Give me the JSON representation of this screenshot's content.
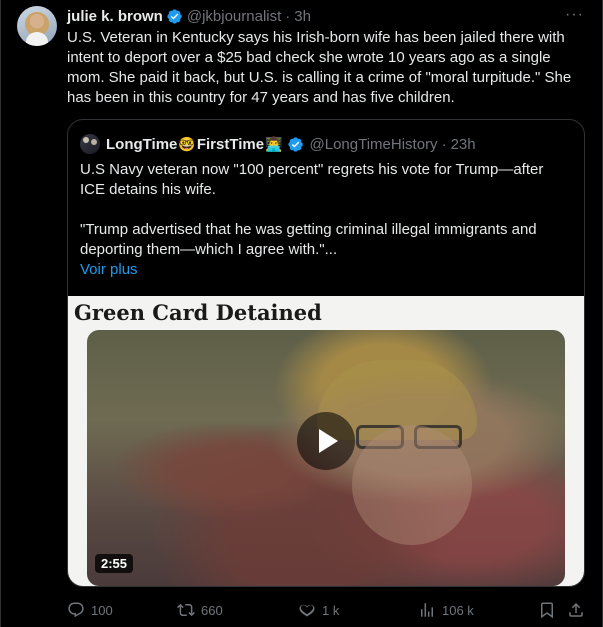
{
  "tweet": {
    "author_name": "julie k. brown",
    "handle": "@jkbjournalist",
    "separator": "·",
    "time": "3h",
    "more_label": "···",
    "text": "U.S. Veteran in Kentucky says his Irish-born wife has been jailed there with intent to deport over a $25 bad check she wrote 10 years ago as a single mom. She paid it back, but U.S. is calling it a crime of \"moral turpitude.\" She has been in this country for 47 years and has five children."
  },
  "quote": {
    "name_part1": "LongTime",
    "emoji1": "🤓",
    "name_part2": "FirstTime",
    "emoji2": "👨‍💻",
    "handle": "@LongTimeHistory",
    "separator": "·",
    "time": "23h",
    "paragraph1": "U.S Navy veteran now \"100 percent\" regrets his vote for Trump—after ICE detains his wife.",
    "paragraph2": "\"Trump advertised that he was getting criminal illegal immigrants and deporting them—which I agree with.\"...",
    "show_more": "Voir plus",
    "media": {
      "headline": "Green Card Detained",
      "duration": "2:55"
    }
  },
  "actions": {
    "replies": "100",
    "retweets": "660",
    "likes": "1 k",
    "views": "106 k"
  },
  "colors": {
    "background": "#000000",
    "text": "#e7e9ea",
    "muted": "#71767b",
    "accent": "#1d9bf0",
    "border": "#2f3336"
  }
}
